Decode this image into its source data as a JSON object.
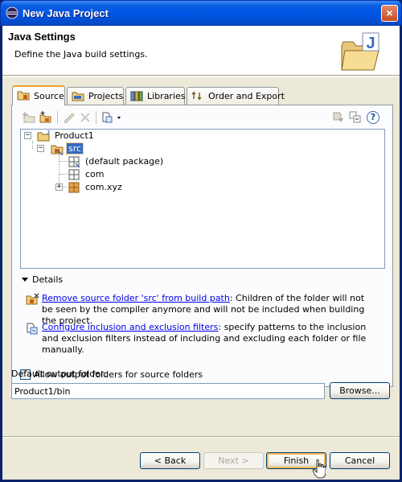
{
  "window": {
    "title": "New Java Project",
    "close_glyph": "×"
  },
  "banner": {
    "heading": "Java Settings",
    "description": "Define the Java build settings.",
    "art_icon": "java-project-folder-icon"
  },
  "tabs": [
    {
      "label": "Source",
      "icon": "source-folder-icon",
      "active": true
    },
    {
      "label": "Projects",
      "icon": "projects-icon",
      "active": false
    },
    {
      "label": "Libraries",
      "icon": "libraries-icon",
      "active": false
    },
    {
      "label": "Order and Export",
      "icon": "order-export-icon",
      "active": false
    }
  ],
  "tree": {
    "project": "Product1",
    "source_folder": "src",
    "packages": [
      "(default package)",
      "com",
      "com.xyz"
    ]
  },
  "details": {
    "label": "Details",
    "remove_link": "Remove source folder 'src' from build path",
    "remove_text": ": Children of the folder will not be seen by the compiler anymore and will not be included when building the project.",
    "configure_link": "Configure inclusion and exclusion filters",
    "configure_text": ": specify patterns to the inclusion and exclusion filters instead of including and excluding each folder or file manually."
  },
  "allow_output_folders": {
    "label": "Allow output folders for source folders",
    "checked": false
  },
  "output_folder": {
    "label": "Default output folder:",
    "value": "Product1/bin",
    "browse_label": "Browse..."
  },
  "buttons": {
    "back": "< Back",
    "next": "Next >",
    "finish": "Finish",
    "cancel": "Cancel"
  }
}
